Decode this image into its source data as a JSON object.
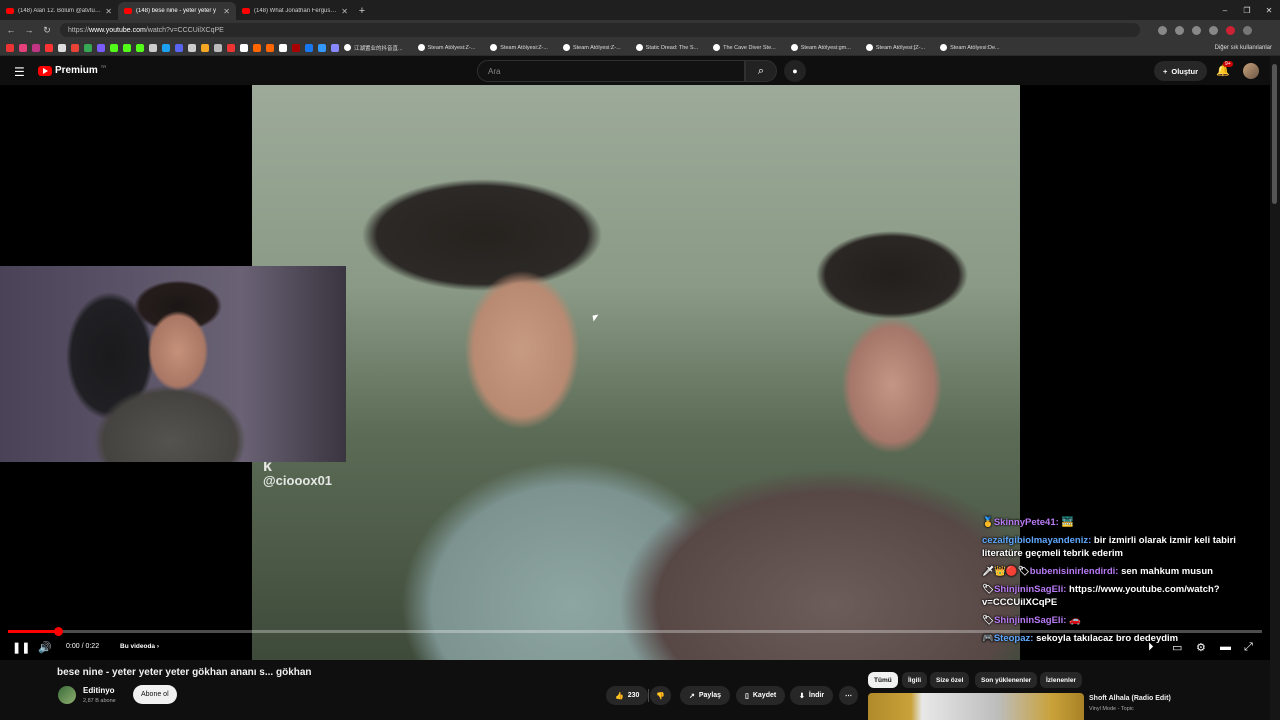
{
  "browser": {
    "tabs": [
      {
        "title": "(148) Alan 12. Bölüm @atvturkiye",
        "active": false
      },
      {
        "title": "(148) bese nine - yeter yeter y",
        "active": true
      },
      {
        "title": "(148) What Jonathan Ferguson thi",
        "active": false
      }
    ],
    "url_prefix": "https://",
    "url_domain": "www.youtube.com",
    "url_path": "/watch?v=CCCUilXCqPE",
    "bookmarks": [
      "江湖置业的抖音直...",
      "Steam Atölyesi:Z-...",
      "Steam Atölyesi:Z-...",
      "Steam Atölyesi:Z-...",
      "Static Dread: The S...",
      "The Cave Diver Ste...",
      "Steam Atölyesi:gm...",
      "Steam Atölyesi:[Z-...",
      "Steam Atölyesi:De..."
    ],
    "other_bookmarks": "Diğer sık kullanılanlar"
  },
  "header": {
    "logo_text": "Premium",
    "logo_region": "TR",
    "search_placeholder": "Ara",
    "create_label": "Oluştur",
    "notification_count": "9+"
  },
  "player": {
    "watermark_top": "k",
    "watermark_handle": "@ciooox01",
    "progress": 0.04,
    "time": "0:00 / 0:22",
    "chapter_label": "Bu videoda",
    "chapter_chevron": "›"
  },
  "chat": [
    {
      "user": "SkinnyPete41:",
      "badge": "🥇",
      "text": "🚟",
      "user_class": ""
    },
    {
      "user": "cezaifgibiolmayandeniz:",
      "badge": "",
      "text": "bir izmirli olarak izmir keli tabiri literatüre geçmeli tebrik ederim",
      "user_class": "blue"
    },
    {
      "user": "bubenisinirlendirdi:",
      "badge": "🗡👑🔴🏷",
      "text": "sen mahkum musun",
      "user_class": ""
    },
    {
      "user": "ShinjininSagEli:",
      "badge": "🏷",
      "text": "https://www.youtube.com/watch?v=CCCUilXCqPE",
      "user_class": ""
    },
    {
      "user": "ShinjininSagEli:",
      "badge": "🏷",
      "text": "🚗",
      "user_class": ""
    },
    {
      "user": "Steopaz:",
      "badge": "🎮",
      "text": "sekoyla takılacaz bro dedeydim",
      "user_class": "blue"
    }
  ],
  "video": {
    "title": "bese nine - yeter yeter yeter gökhan ananı s... gökhan",
    "channel_name": "Editinyo",
    "subscribers": "2,87 B abone",
    "subscribe_label": "Abone ol",
    "likes": "230",
    "share_label": "Paylaş",
    "save_label": "Kaydet",
    "download_label": "İndir",
    "more_label": "⋯"
  },
  "chips": [
    "Tümü",
    "İlgili",
    "Size özel",
    "Son yüklenenler",
    "İzlenenler"
  ],
  "recommendation": {
    "title": "Shoft Alhala (Radio Edit)",
    "channel": "Vinyl Mode - Topic"
  },
  "colors": {
    "accent": "#ff0000",
    "background": "#0f0f0f",
    "chat_user": "#b87af5"
  }
}
